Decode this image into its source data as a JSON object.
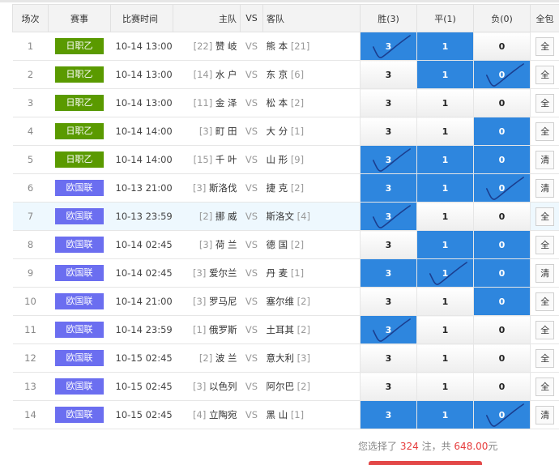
{
  "headers": {
    "no": "场次",
    "league": "赛事",
    "time": "比赛时间",
    "home": "主队",
    "vs": "VS",
    "away": "客队",
    "win": "胜(3)",
    "draw": "平(1)",
    "lose": "负(0)",
    "pack": "全包"
  },
  "league_colors": {
    "日职乙": "#5a9a00",
    "欧国联": "#6b6ef0"
  },
  "odd_on_color": "#2e86de",
  "rows": [
    {
      "no": "1",
      "league": "日职乙",
      "time": "10-14 13:00",
      "home_rank": "[22]",
      "home": "赞 岐",
      "vs": "VS",
      "away": "熊 本",
      "away_rank": "[21]",
      "w": "3",
      "d": "1",
      "l": "0",
      "pack": "全",
      "sel": [
        1,
        1,
        0
      ],
      "ticks": [
        1,
        0,
        0
      ],
      "hl": false
    },
    {
      "no": "2",
      "league": "日职乙",
      "time": "10-14 13:00",
      "home_rank": "[14]",
      "home": "水 户",
      "vs": "VS",
      "away": "东 京",
      "away_rank": "[6]",
      "w": "3",
      "d": "1",
      "l": "0",
      "pack": "全",
      "sel": [
        0,
        1,
        1
      ],
      "ticks": [
        0,
        0,
        1
      ],
      "hl": false
    },
    {
      "no": "3",
      "league": "日职乙",
      "time": "10-14 13:00",
      "home_rank": "[11]",
      "home": "金 泽",
      "vs": "VS",
      "away": "松 本",
      "away_rank": "[2]",
      "w": "3",
      "d": "1",
      "l": "0",
      "pack": "全",
      "sel": [
        0,
        0,
        0
      ],
      "ticks": [
        0,
        0,
        0
      ],
      "hl": false
    },
    {
      "no": "4",
      "league": "日职乙",
      "time": "10-14 14:00",
      "home_rank": "[3]",
      "home": "町 田",
      "vs": "VS",
      "away": "大 分",
      "away_rank": "[1]",
      "w": "3",
      "d": "1",
      "l": "0",
      "pack": "全",
      "sel": [
        0,
        0,
        1
      ],
      "ticks": [
        0,
        0,
        0
      ],
      "hl": false
    },
    {
      "no": "5",
      "league": "日职乙",
      "time": "10-14 14:00",
      "home_rank": "[15]",
      "home": "千 叶",
      "vs": "VS",
      "away": "山 形",
      "away_rank": "[9]",
      "w": "3",
      "d": "1",
      "l": "0",
      "pack": "清",
      "sel": [
        1,
        1,
        1
      ],
      "ticks": [
        1,
        0,
        0
      ],
      "hl": false
    },
    {
      "no": "6",
      "league": "欧国联",
      "time": "10-13 21:00",
      "home_rank": "[3]",
      "home": "斯洛伐",
      "vs": "VS",
      "away": "捷 克",
      "away_rank": "[2]",
      "w": "3",
      "d": "1",
      "l": "0",
      "pack": "清",
      "sel": [
        1,
        1,
        1
      ],
      "ticks": [
        0,
        0,
        1
      ],
      "hl": false
    },
    {
      "no": "7",
      "league": "欧国联",
      "time": "10-13 23:59",
      "home_rank": "[2]",
      "home": "挪 威",
      "vs": "VS",
      "away": "斯洛文",
      "away_rank": "[4]",
      "w": "3",
      "d": "1",
      "l": "0",
      "pack": "全",
      "sel": [
        1,
        0,
        0
      ],
      "ticks": [
        1,
        0,
        0
      ],
      "hl": true
    },
    {
      "no": "8",
      "league": "欧国联",
      "time": "10-14 02:45",
      "home_rank": "[3]",
      "home": "荷 兰",
      "vs": "VS",
      "away": "德 国",
      "away_rank": "[2]",
      "w": "3",
      "d": "1",
      "l": "0",
      "pack": "全",
      "sel": [
        0,
        1,
        1
      ],
      "ticks": [
        0,
        0,
        0
      ],
      "hl": false
    },
    {
      "no": "9",
      "league": "欧国联",
      "time": "10-14 02:45",
      "home_rank": "[3]",
      "home": "爱尔兰",
      "vs": "VS",
      "away": "丹 麦",
      "away_rank": "[1]",
      "w": "3",
      "d": "1",
      "l": "0",
      "pack": "清",
      "sel": [
        1,
        1,
        1
      ],
      "ticks": [
        0,
        1,
        0
      ],
      "hl": false
    },
    {
      "no": "10",
      "league": "欧国联",
      "time": "10-14 21:00",
      "home_rank": "[3]",
      "home": "罗马尼",
      "vs": "VS",
      "away": "塞尔维",
      "away_rank": "[2]",
      "w": "3",
      "d": "1",
      "l": "0",
      "pack": "全",
      "sel": [
        0,
        0,
        1
      ],
      "ticks": [
        0,
        0,
        0
      ],
      "hl": false
    },
    {
      "no": "11",
      "league": "欧国联",
      "time": "10-14 23:59",
      "home_rank": "[1]",
      "home": "俄罗斯",
      "vs": "VS",
      "away": "土耳其",
      "away_rank": "[2]",
      "w": "3",
      "d": "1",
      "l": "0",
      "pack": "全",
      "sel": [
        1,
        0,
        0
      ],
      "ticks": [
        1,
        0,
        0
      ],
      "hl": false
    },
    {
      "no": "12",
      "league": "欧国联",
      "time": "10-15 02:45",
      "home_rank": "[2]",
      "home": "波 兰",
      "vs": "VS",
      "away": "意大利",
      "away_rank": "[3]",
      "w": "3",
      "d": "1",
      "l": "0",
      "pack": "全",
      "sel": [
        0,
        0,
        0
      ],
      "ticks": [
        0,
        0,
        0
      ],
      "hl": false
    },
    {
      "no": "13",
      "league": "欧国联",
      "time": "10-15 02:45",
      "home_rank": "[3]",
      "home": "以色列",
      "vs": "VS",
      "away": "阿尔巴",
      "away_rank": "[2]",
      "w": "3",
      "d": "1",
      "l": "0",
      "pack": "全",
      "sel": [
        0,
        0,
        0
      ],
      "ticks": [
        0,
        0,
        0
      ],
      "hl": false
    },
    {
      "no": "14",
      "league": "欧国联",
      "time": "10-15 02:45",
      "home_rank": "[4]",
      "home": "立陶宛",
      "vs": "VS",
      "away": "黑 山",
      "away_rank": "[1]",
      "w": "3",
      "d": "1",
      "l": "0",
      "pack": "清",
      "sel": [
        1,
        1,
        1
      ],
      "ticks": [
        0,
        0,
        1
      ],
      "hl": false
    }
  ],
  "footer": {
    "prefix": "您选择了",
    "count": "324",
    "mid": "注，共",
    "amount": "648.00",
    "suffix": "元"
  }
}
